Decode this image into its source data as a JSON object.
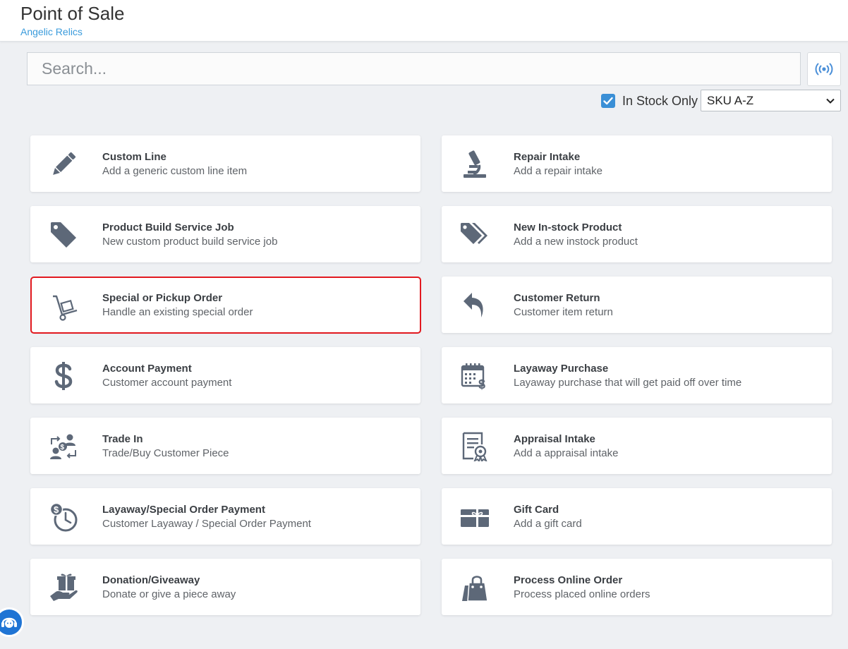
{
  "header": {
    "title": "Point of Sale",
    "subtitle": "Angelic Relics"
  },
  "search": {
    "placeholder": "Search..."
  },
  "filters": {
    "in_stock_label": "In Stock Only",
    "in_stock_checked": true,
    "sort_value": "SKU A-Z"
  },
  "colors": {
    "accent": "#3a8fd6",
    "icon": "#5d6878",
    "highlight": "#e2191f"
  },
  "cards": [
    {
      "title": "Custom Line",
      "desc": "Add a generic custom line item",
      "icon": "pencil-icon"
    },
    {
      "title": "Repair Intake",
      "desc": "Add a repair intake",
      "icon": "microscope-icon"
    },
    {
      "title": "Product Build Service Job",
      "desc": "New custom product build service job",
      "icon": "tag-icon"
    },
    {
      "title": "New In-stock Product",
      "desc": "Add a new instock product",
      "icon": "tags-icon"
    },
    {
      "title": "Special or Pickup Order",
      "desc": "Handle an existing special order",
      "icon": "dolly-icon"
    },
    {
      "title": "Customer Return",
      "desc": "Customer item return",
      "icon": "reply-icon"
    },
    {
      "title": "Account Payment",
      "desc": "Customer account payment",
      "icon": "dollar-icon"
    },
    {
      "title": "Layaway Purchase",
      "desc": "Layaway purchase that will get paid off over time",
      "icon": "calendar-dollar-icon"
    },
    {
      "title": "Trade In",
      "desc": "Trade/Buy Customer Piece",
      "icon": "exchange-people-icon"
    },
    {
      "title": "Appraisal Intake",
      "desc": "Add a appraisal intake",
      "icon": "certificate-icon"
    },
    {
      "title": "Layaway/Special Order Payment",
      "desc": "Customer Layaway / Special Order Payment",
      "icon": "clock-dollar-icon"
    },
    {
      "title": "Gift Card",
      "desc": "Add a gift card",
      "icon": "gift-card-icon"
    },
    {
      "title": "Donation/Giveaway",
      "desc": "Donate or give a piece away",
      "icon": "hand-gift-icon"
    },
    {
      "title": "Process Online Order",
      "desc": "Process placed online orders",
      "icon": "shopping-bag-icon"
    }
  ]
}
